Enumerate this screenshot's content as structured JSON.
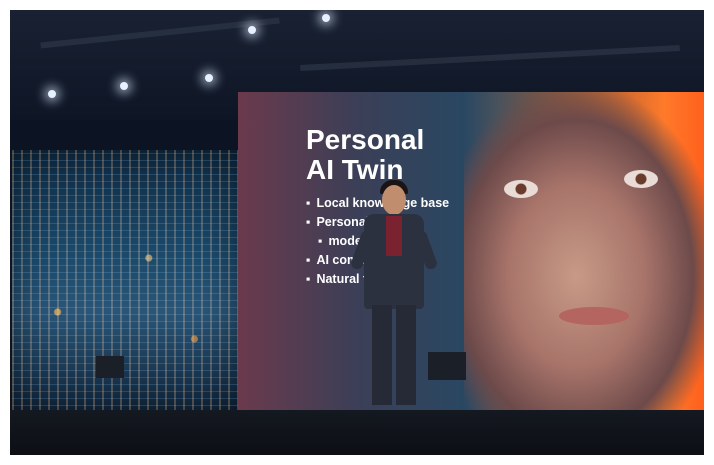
{
  "slide": {
    "title": "Personal\nAI Twin",
    "bullets": [
      "Local knowledge base",
      "Personal    ation",
      "model",
      "AI comp",
      "Natural      tions"
    ]
  },
  "colors": {
    "accent": "#ff6a22",
    "screen_blue": "#1a3a55",
    "stage": "#0b0d12"
  }
}
